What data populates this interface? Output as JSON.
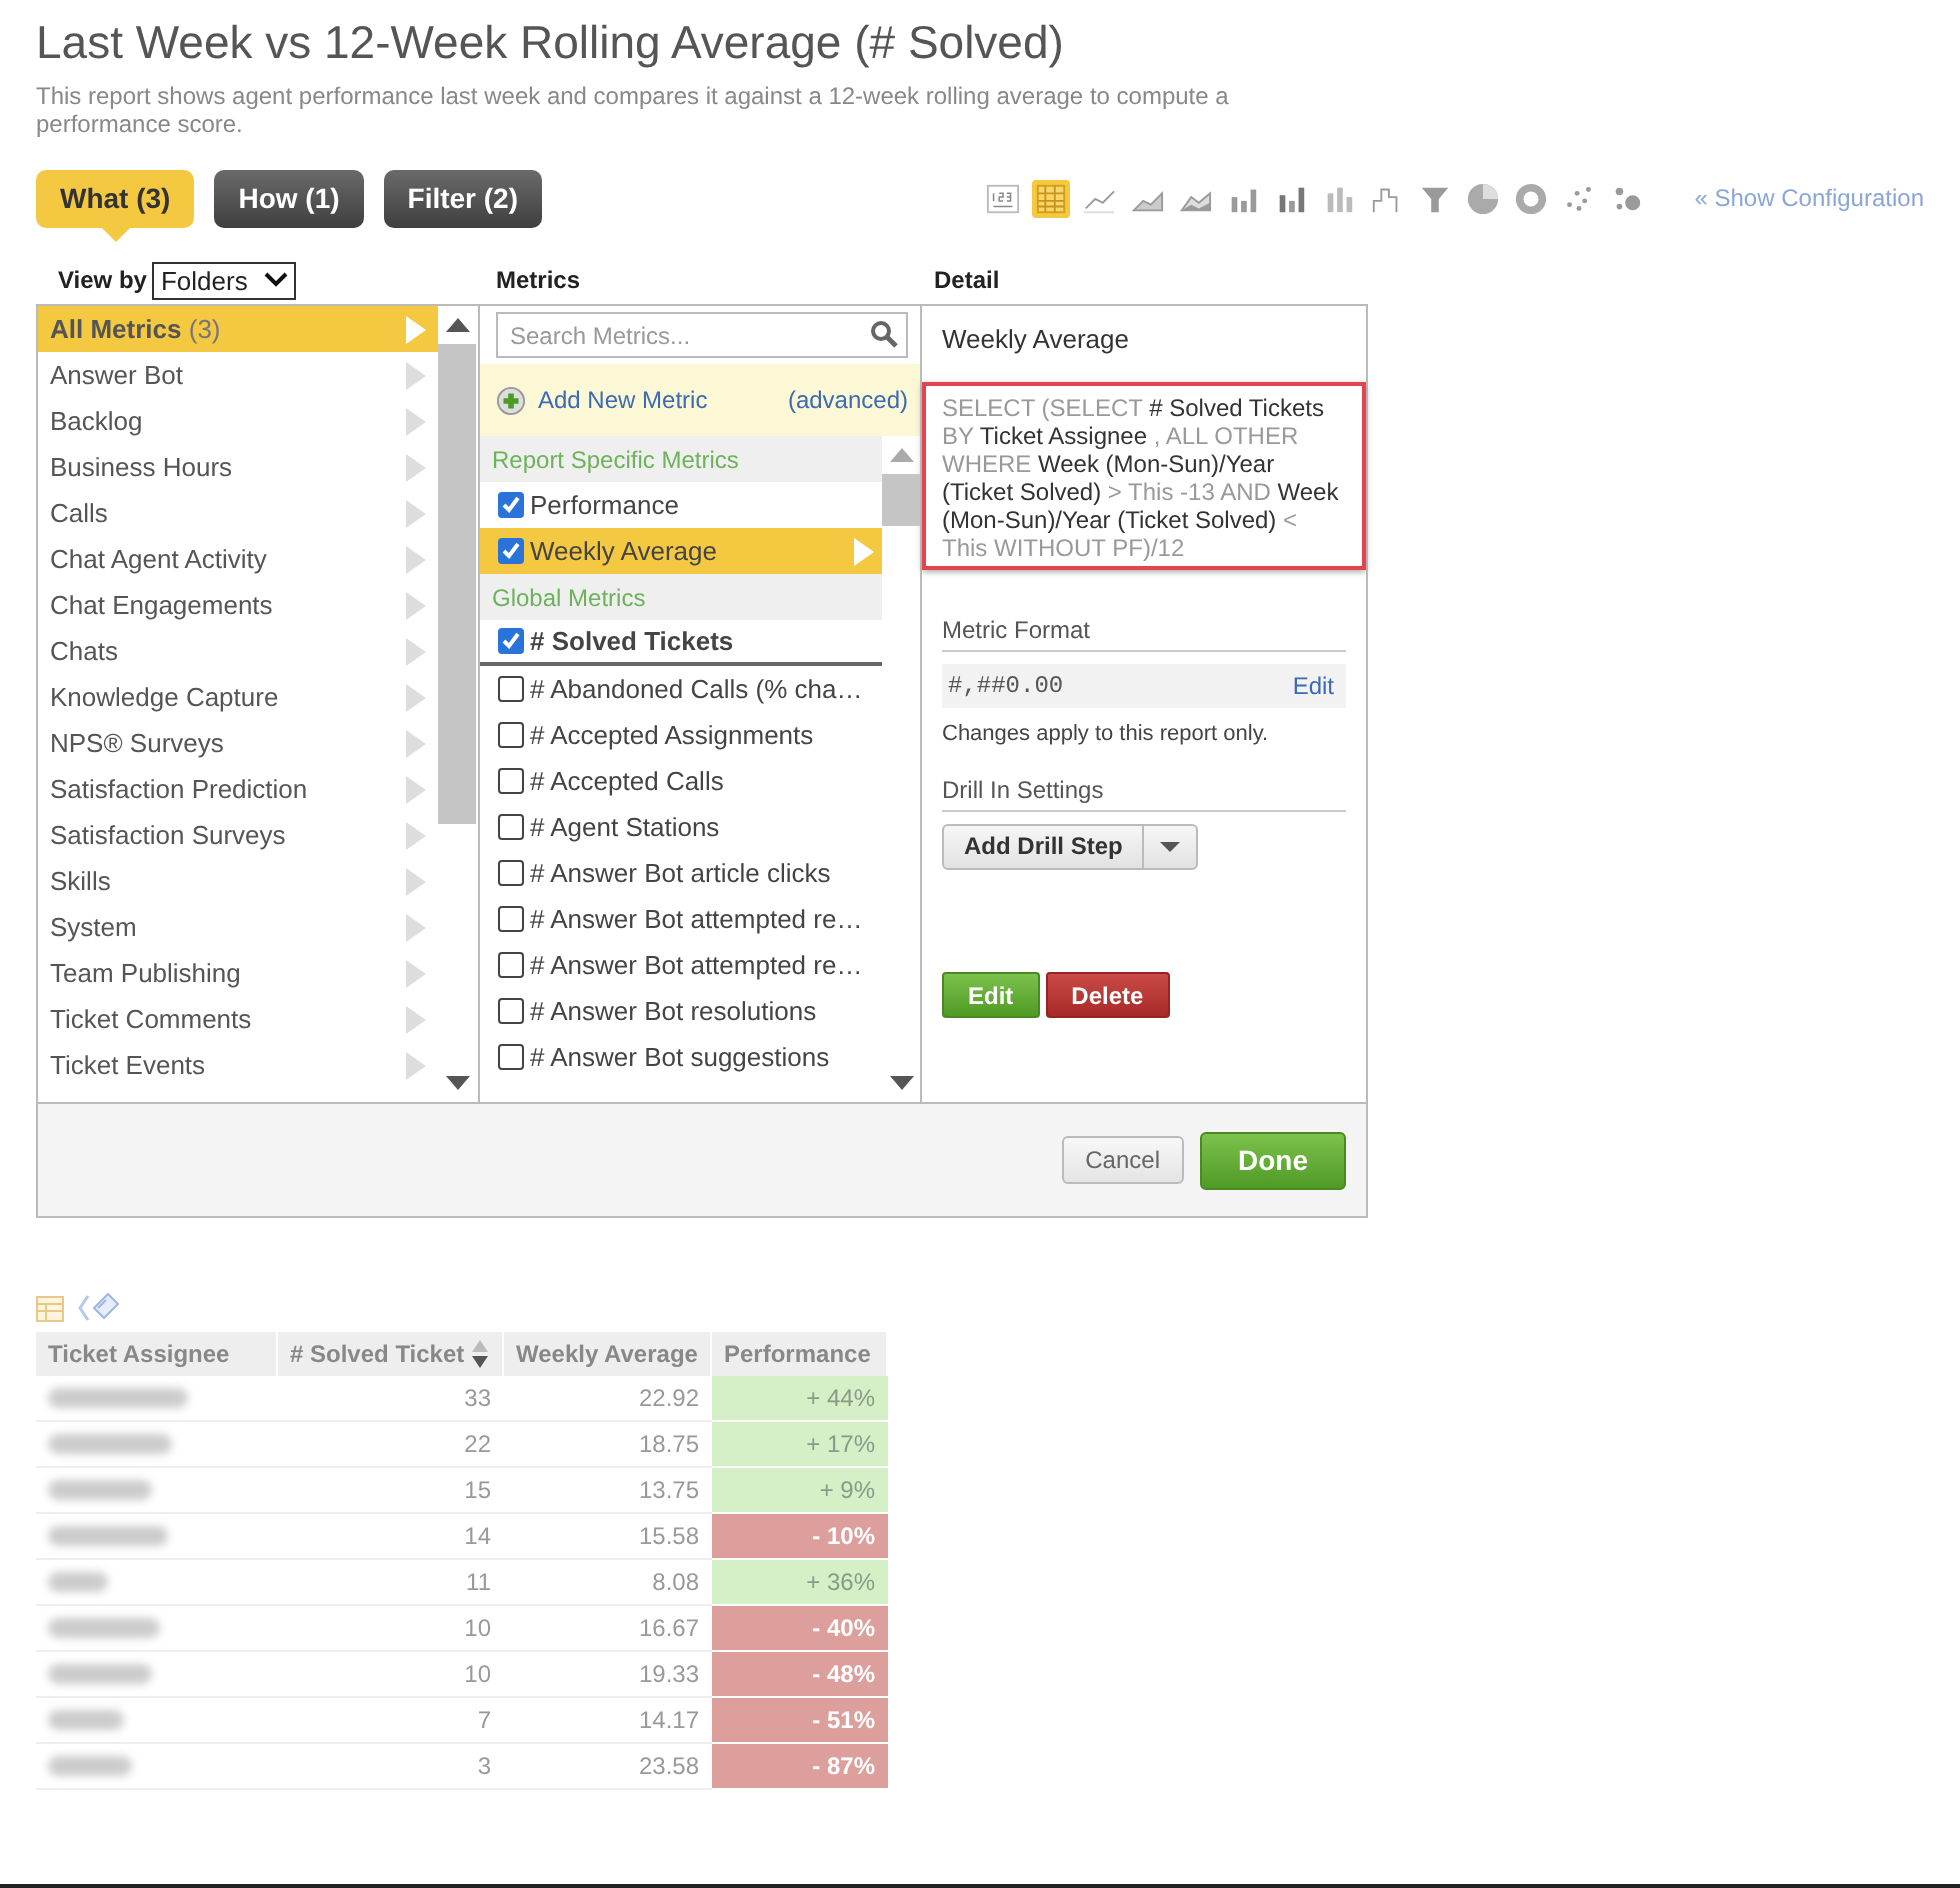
{
  "title": "Last Week vs 12-Week Rolling Average (# Solved)",
  "description": "This report shows agent performance last week and compares it against a 12-week rolling average to compute a performance score.",
  "tabs": [
    {
      "label": "What (3)",
      "selected": true
    },
    {
      "label": "How (1)",
      "selected": false
    },
    {
      "label": "Filter (2)",
      "selected": false
    }
  ],
  "chart_types": [
    {
      "kind": "number",
      "selected": false
    },
    {
      "kind": "table",
      "selected": true
    },
    {
      "kind": "line",
      "selected": false
    },
    {
      "kind": "area",
      "selected": false
    },
    {
      "kind": "stacked-area",
      "selected": false
    },
    {
      "kind": "bar",
      "selected": false
    },
    {
      "kind": "stacked-bar",
      "selected": false
    },
    {
      "kind": "bar-percent",
      "selected": false
    },
    {
      "kind": "waterfall",
      "selected": false
    },
    {
      "kind": "funnel",
      "selected": false
    },
    {
      "kind": "pie",
      "selected": false
    },
    {
      "kind": "donut",
      "selected": false
    },
    {
      "kind": "scatter",
      "selected": false
    },
    {
      "kind": "bubble",
      "selected": false
    }
  ],
  "show_configuration": "« Show Configuration",
  "view_by": {
    "label": "View by",
    "value": "Folders"
  },
  "headings": {
    "metrics": "Metrics",
    "detail": "Detail"
  },
  "folders": [
    {
      "label": "All Metrics",
      "count": "(3)",
      "selected": true
    },
    {
      "label": "Answer Bot",
      "selected": false
    },
    {
      "label": "Backlog",
      "selected": false
    },
    {
      "label": "Business Hours",
      "selected": false
    },
    {
      "label": "Calls",
      "selected": false
    },
    {
      "label": "Chat Agent Activity",
      "selected": false
    },
    {
      "label": "Chat Engagements",
      "selected": false
    },
    {
      "label": "Chats",
      "selected": false
    },
    {
      "label": "Knowledge Capture",
      "selected": false
    },
    {
      "label": "NPS® Surveys",
      "selected": false
    },
    {
      "label": "Satisfaction Prediction",
      "selected": false
    },
    {
      "label": "Satisfaction Surveys",
      "selected": false
    },
    {
      "label": "Skills",
      "selected": false
    },
    {
      "label": "System",
      "selected": false
    },
    {
      "label": "Team Publishing",
      "selected": false
    },
    {
      "label": "Ticket Comments",
      "selected": false
    },
    {
      "label": "Ticket Events",
      "selected": false
    }
  ],
  "metrics": {
    "search": {
      "placeholder": "Search Metrics..."
    },
    "add_new": "Add New Metric",
    "advanced": "(advanced)",
    "sections": [
      {
        "title": "Report Specific Metrics",
        "items": [
          {
            "label": "Performance",
            "checked": true,
            "selected": false,
            "kind": "regular"
          },
          {
            "label": "Weekly Average",
            "checked": true,
            "selected": true,
            "kind": "regular"
          }
        ]
      },
      {
        "title": "Global Metrics",
        "items": [
          {
            "label": "# Solved Tickets",
            "checked": true,
            "selected": false,
            "kind": "primary"
          },
          {
            "label": "# Abandoned Calls (% cha…",
            "checked": false,
            "selected": false,
            "kind": "regular"
          },
          {
            "label": "# Accepted Assignments",
            "checked": false,
            "selected": false,
            "kind": "regular"
          },
          {
            "label": "# Accepted Calls",
            "checked": false,
            "selected": false,
            "kind": "regular"
          },
          {
            "label": "# Agent Stations",
            "checked": false,
            "selected": false,
            "kind": "regular"
          },
          {
            "label": "# Answer Bot article clicks",
            "checked": false,
            "selected": false,
            "kind": "regular"
          },
          {
            "label": "# Answer Bot attempted re…",
            "checked": false,
            "selected": false,
            "kind": "regular"
          },
          {
            "label": "# Answer Bot attempted re…",
            "checked": false,
            "selected": false,
            "kind": "regular"
          },
          {
            "label": "# Answer Bot resolutions",
            "checked": false,
            "selected": false,
            "kind": "regular"
          },
          {
            "label": "# Answer Bot suggestions",
            "checked": false,
            "selected": false,
            "kind": "regular"
          }
        ]
      }
    ]
  },
  "detail": {
    "title": "Weekly Average",
    "definition": [
      {
        "kind": "keyword",
        "text": "SELECT (SELECT"
      },
      {
        "kind": "name",
        "text": "# Solved Tickets"
      },
      {
        "kind": "keyword",
        "text": "BY"
      },
      {
        "kind": "name",
        "text": "Ticket Assignee"
      },
      {
        "kind": "keyword",
        "text": ", ALL OTHER WHERE"
      },
      {
        "kind": "name",
        "text": "Week (Mon-Sun)/Year (Ticket Solved)"
      },
      {
        "kind": "keyword",
        "text": "> This -13 AND"
      },
      {
        "kind": "name",
        "text": "Week (Mon-Sun)/Year (Ticket Solved)"
      },
      {
        "kind": "keyword",
        "text": "< This WITHOUT PF)/12"
      }
    ],
    "format_label": "Metric Format",
    "format_value": "#,##0.00",
    "format_edit": "Edit",
    "format_note": "Changes apply to this report only.",
    "drill_label": "Drill In Settings",
    "drill_button": "Add Drill Step",
    "edit": "Edit",
    "delete": "Delete"
  },
  "footer": {
    "cancel": "Cancel",
    "done": "Done"
  },
  "table": {
    "columns": [
      {
        "label": "Ticket Assignee",
        "sorted": false
      },
      {
        "label": "# Solved Ticket",
        "sorted": true
      },
      {
        "label": "Weekly Average",
        "sorted": false
      },
      {
        "label": "Performance",
        "sorted": false
      }
    ],
    "rows": [
      {
        "solved": "33",
        "average": "22.92",
        "performance": "+ 44%",
        "color": "#d5efc6"
      },
      {
        "solved": "22",
        "average": "18.75",
        "performance": "+ 17%",
        "color": "#d5efc6"
      },
      {
        "solved": "15",
        "average": "13.75",
        "performance": "+ 9%",
        "color": "#d5efc6"
      },
      {
        "solved": "14",
        "average": "15.58",
        "performance": "- 10%",
        "color": "#dc9f9c"
      },
      {
        "solved": "11",
        "average": "8.08",
        "performance": "+ 36%",
        "color": "#d5efc6"
      },
      {
        "solved": "10",
        "average": "16.67",
        "performance": "- 40%",
        "color": "#dc9f9c"
      },
      {
        "solved": "10",
        "average": "19.33",
        "performance": "- 48%",
        "color": "#dc9f9c"
      },
      {
        "solved": "7",
        "average": "14.17",
        "performance": "- 51%",
        "color": "#dc9f9c"
      },
      {
        "solved": "3",
        "average": "23.58",
        "performance": "- 87%",
        "color": "#dc9f9c"
      }
    ]
  }
}
